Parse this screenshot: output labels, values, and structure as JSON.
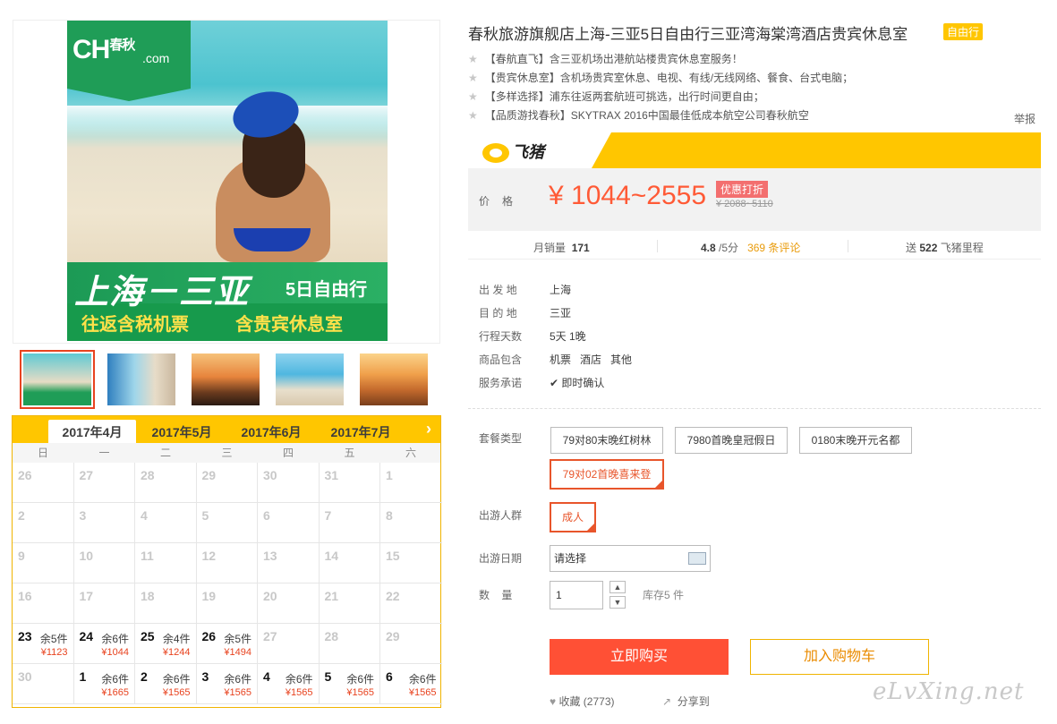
{
  "gallery": {
    "poster": {
      "logo": "CH",
      "logo_cn": "春秋",
      "logo_com": ".com",
      "route": "上海－三亚",
      "days": "5日自由行",
      "tag1": "往返含税机票",
      "tag2": "含贵宾休息室"
    }
  },
  "calendar": {
    "months": [
      "2017年4月",
      "2017年5月",
      "2017年6月",
      "2017年7月"
    ],
    "active_month": 0,
    "weekdays": [
      "日",
      "一",
      "二",
      "三",
      "四",
      "五",
      "六"
    ],
    "rows": [
      [
        {
          "d": "26"
        },
        {
          "d": "27"
        },
        {
          "d": "28"
        },
        {
          "d": "29"
        },
        {
          "d": "30"
        },
        {
          "d": "31"
        },
        {
          "d": "1"
        }
      ],
      [
        {
          "d": "2"
        },
        {
          "d": "3"
        },
        {
          "d": "4"
        },
        {
          "d": "5"
        },
        {
          "d": "6"
        },
        {
          "d": "7"
        },
        {
          "d": "8"
        }
      ],
      [
        {
          "d": "9"
        },
        {
          "d": "10"
        },
        {
          "d": "11"
        },
        {
          "d": "12"
        },
        {
          "d": "13"
        },
        {
          "d": "14"
        },
        {
          "d": "15"
        }
      ],
      [
        {
          "d": "16"
        },
        {
          "d": "17"
        },
        {
          "d": "18"
        },
        {
          "d": "19"
        },
        {
          "d": "20"
        },
        {
          "d": "21"
        },
        {
          "d": "22"
        }
      ],
      [
        {
          "d": "23",
          "stock": "余5件",
          "price": "¥1123",
          "on": true
        },
        {
          "d": "24",
          "stock": "余6件",
          "price": "¥1044",
          "on": true
        },
        {
          "d": "25",
          "stock": "余4件",
          "price": "¥1244",
          "on": true
        },
        {
          "d": "26",
          "stock": "余5件",
          "price": "¥1494",
          "on": true
        },
        {
          "d": "27"
        },
        {
          "d": "28"
        },
        {
          "d": "29"
        }
      ],
      [
        {
          "d": "30"
        },
        {
          "d": "1",
          "stock": "余6件",
          "price": "¥1665",
          "on": true
        },
        {
          "d": "2",
          "stock": "余6件",
          "price": "¥1565",
          "on": true
        },
        {
          "d": "3",
          "stock": "余6件",
          "price": "¥1565",
          "on": true
        },
        {
          "d": "4",
          "stock": "余6件",
          "price": "¥1565",
          "on": true
        },
        {
          "d": "5",
          "stock": "余6件",
          "price": "¥1565",
          "on": true
        },
        {
          "d": "6",
          "stock": "余6件",
          "price": "¥1565",
          "on": true
        }
      ]
    ]
  },
  "product": {
    "title": "春秋旅游旗舰店上海-三亚5日自由行三亚湾海棠湾酒店贵宾休息室",
    "badge": "自由行",
    "features": [
      "【春航直飞】含三亚机场出港航站楼贵宾休息室服务！",
      "【贵宾休息室】含机场贵宾室休息、电视、有线/无线网络、餐食、台式电脑；",
      "【多样选择】浦东往返两套航班可挑选，出行时间更自由；",
      "【品质游找春秋】SKYTRAX 2016中国最佳低成本航空公司春秋航空"
    ],
    "report": "举报",
    "brand": "飞猪",
    "price_label": "价格",
    "price": "¥ 1044~2555",
    "promo": "优惠打折",
    "orig_price": "¥ 2088~5110",
    "stats": {
      "sales_label": "月销量",
      "sales": "171",
      "rating": "4.8",
      "rating_suffix": "/5分",
      "reviews": "369 条评论",
      "points_prefix": "送",
      "points": "522",
      "points_suffix": "飞猪里程"
    },
    "info": [
      {
        "label": "出 发 地",
        "value": "上海"
      },
      {
        "label": "目 的 地",
        "value": "三亚"
      },
      {
        "label": "行程天数",
        "value": "5天 1晚"
      },
      {
        "label": "商品包含",
        "value": "机票   酒店   其他"
      },
      {
        "label": "服务承诺",
        "value": "即时确认"
      }
    ],
    "package_label": "套餐类型",
    "packages": [
      "79对80末晚红树林",
      "7980首晚皇冠假日",
      "0180末晚开元名都",
      "79对02首晚喜来登"
    ],
    "selected_package": 3,
    "people_label": "出游人群",
    "people": "成人",
    "date_label": "出游日期",
    "date_value": "请选择",
    "qty_label": "数    量",
    "qty": "1",
    "stock_note": "库存5 件",
    "buy": "立即购买",
    "cart": "加入购物车",
    "fav": "收藏 (2773)",
    "share": "分享到"
  },
  "watermark": "eLvXing.net"
}
